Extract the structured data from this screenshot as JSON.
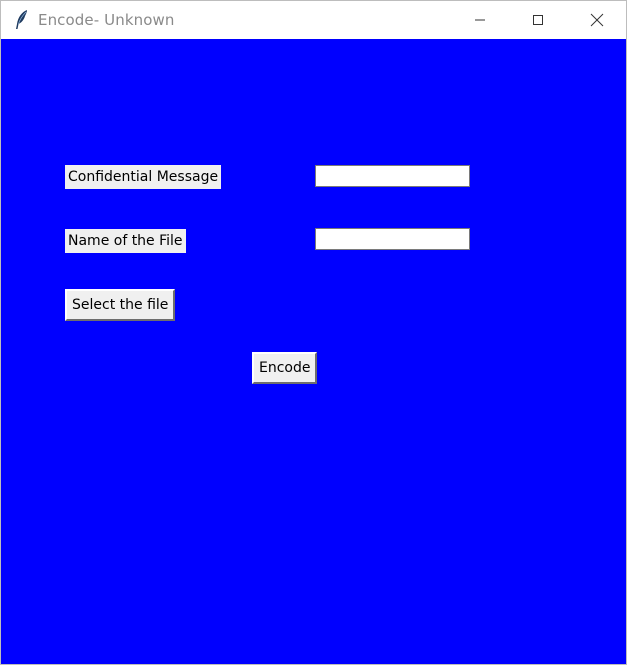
{
  "window": {
    "title": "Encode- Unknown",
    "icon": "feather-icon",
    "background_color": "#0000ff"
  },
  "form": {
    "message_label": "Confidential Message",
    "message_value": "",
    "filename_label": "Name of the File",
    "filename_value": "",
    "select_file_button": "Select the file",
    "encode_button": "Encode"
  }
}
